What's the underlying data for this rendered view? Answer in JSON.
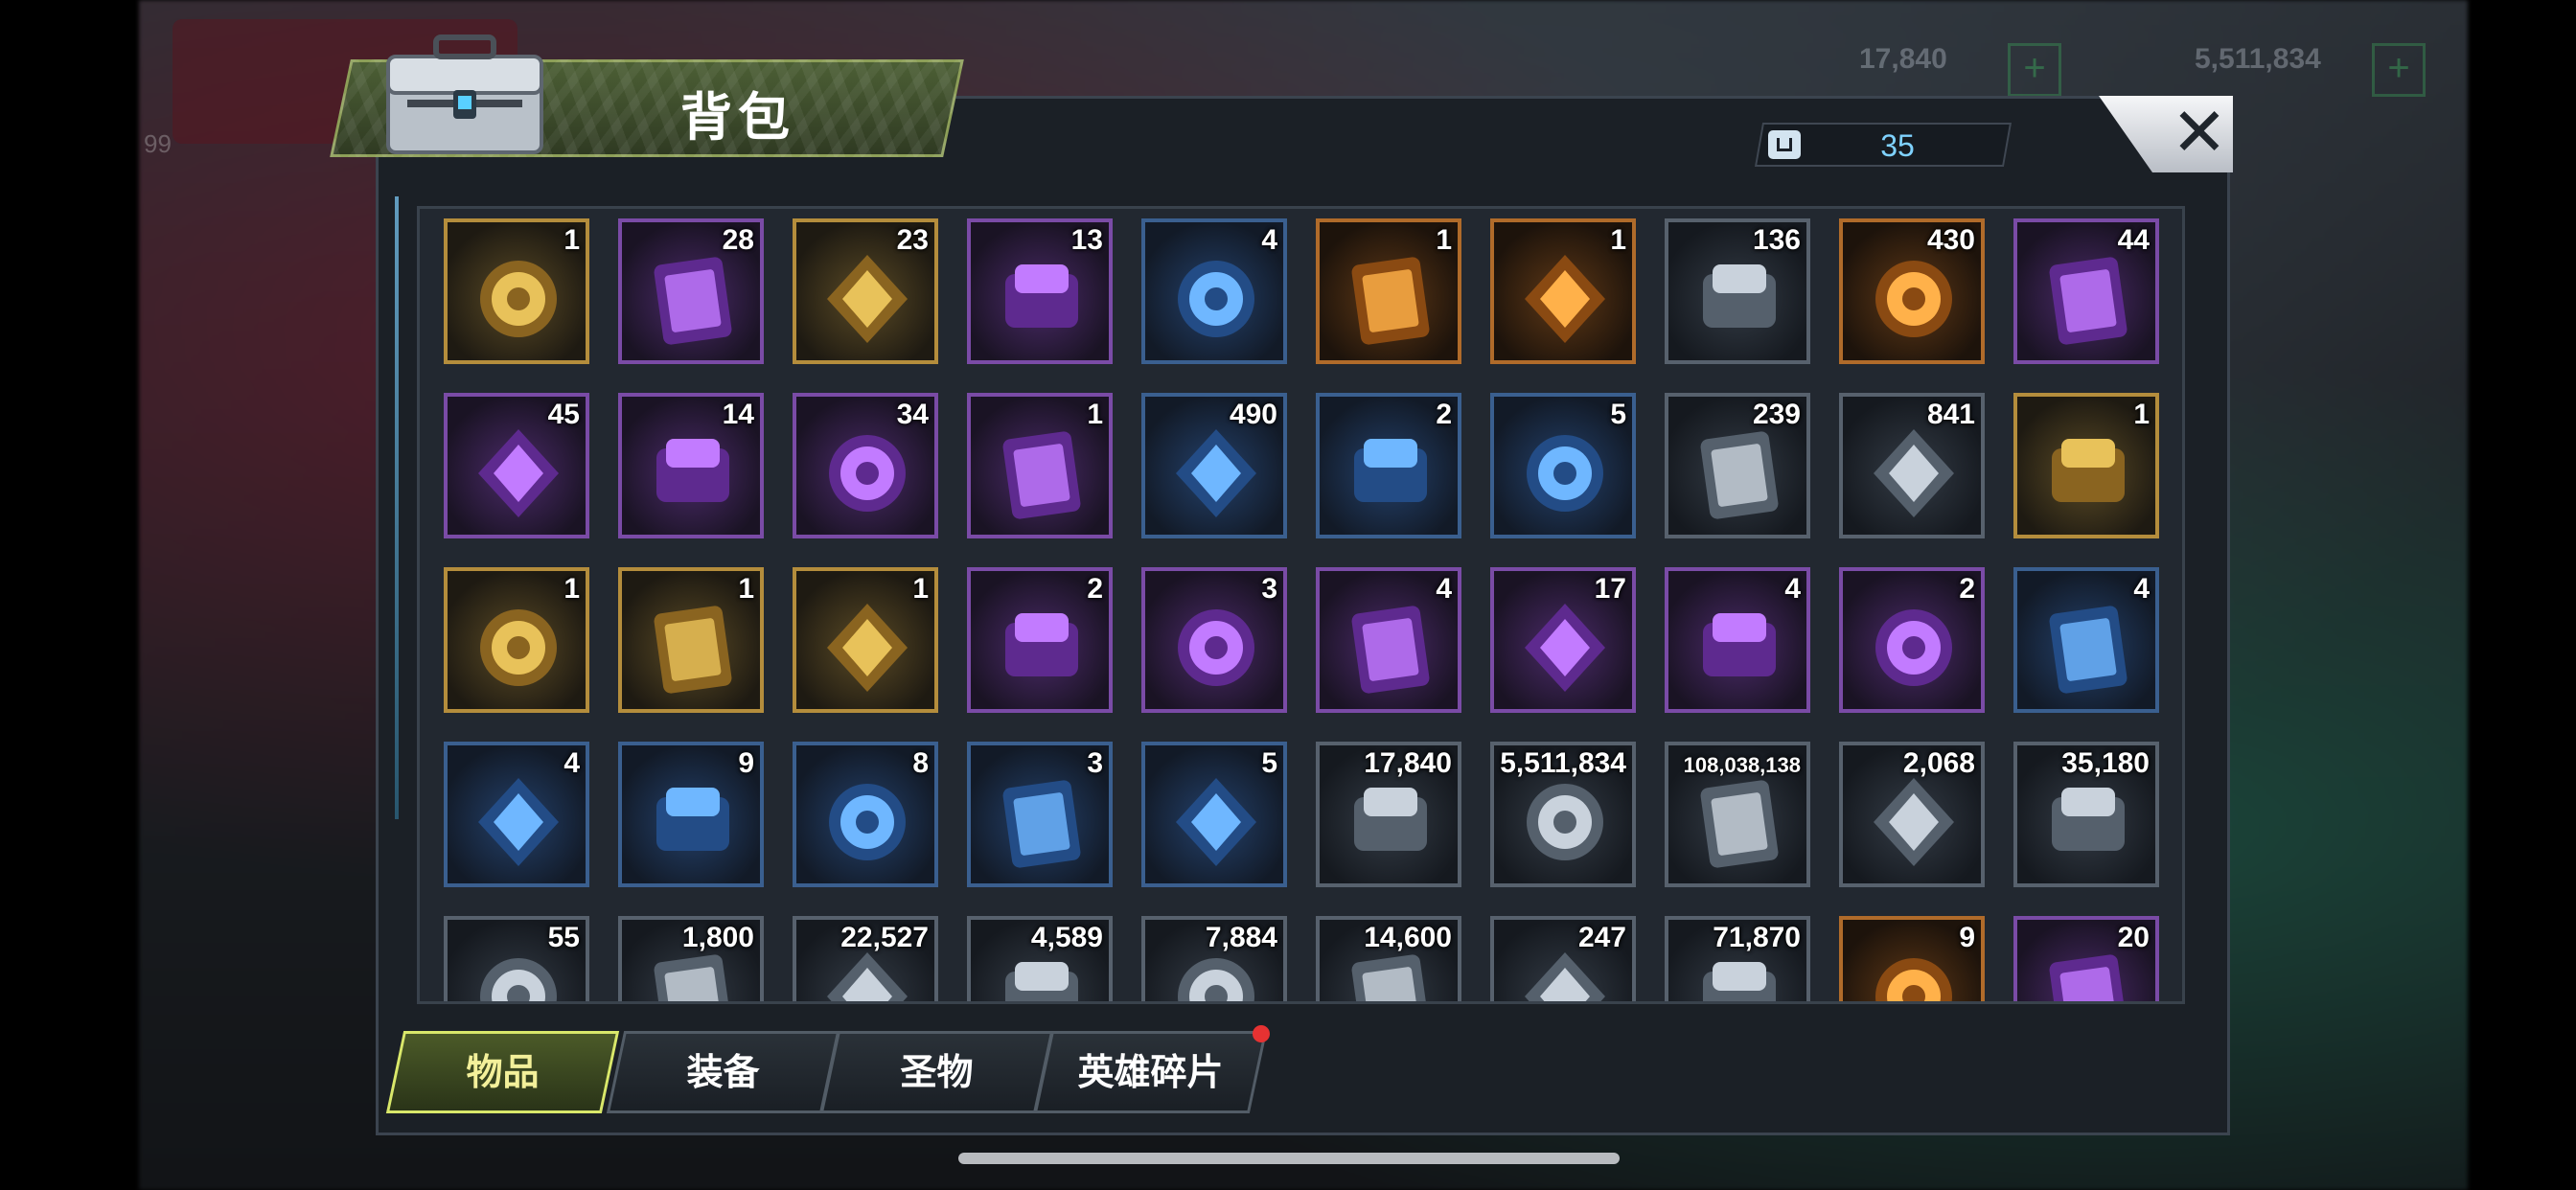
{
  "header": {
    "title": "背包"
  },
  "capacity": {
    "value": "35"
  },
  "background_hud": {
    "res1": "17,840",
    "res2": "5,511,834",
    "level": "99"
  },
  "close": {
    "label": "✕"
  },
  "items": [
    {
      "count": "1",
      "tier": "gold",
      "icon": "weapon-crate-icon"
    },
    {
      "count": "28",
      "tier": "purple",
      "icon": "teleport-device-icon"
    },
    {
      "count": "23",
      "tier": "gold",
      "icon": "speedup-24h-icon"
    },
    {
      "count": "13",
      "tier": "purple",
      "icon": "speedup-12h-icon"
    },
    {
      "count": "4",
      "tier": "blue",
      "icon": "speedup-4h-icon"
    },
    {
      "count": "1",
      "tier": "orange",
      "icon": "green-emblem-icon"
    },
    {
      "count": "1",
      "tier": "orange",
      "icon": "silver-emblem-icon"
    },
    {
      "count": "136",
      "tier": "gray",
      "icon": "bottle-cap-red-icon"
    },
    {
      "count": "430",
      "tier": "orange",
      "icon": "orange-slice-icon"
    },
    {
      "count": "44",
      "tier": "purple",
      "icon": "film-reel-icon"
    },
    {
      "count": "45",
      "tier": "purple",
      "icon": "bottle-cap-purple-icon"
    },
    {
      "count": "14",
      "tier": "purple",
      "icon": "poker-chip-purple-icon"
    },
    {
      "count": "34",
      "tier": "purple",
      "icon": "police-badge-icon"
    },
    {
      "count": "1",
      "tier": "purple",
      "icon": "lightsaber-icon"
    },
    {
      "count": "490",
      "tier": "blue",
      "icon": "cinema-ticket-icon"
    },
    {
      "count": "2",
      "tier": "blue",
      "icon": "timer-token-icon"
    },
    {
      "count": "5",
      "tier": "blue",
      "icon": "bottle-cap-blue-icon"
    },
    {
      "count": "239",
      "tier": "gray",
      "icon": "poker-chip-red-icon"
    },
    {
      "count": "841",
      "tier": "gray",
      "icon": "bullet-icon"
    },
    {
      "count": "1",
      "tier": "gold",
      "icon": "shirt-blueprint-gold-icon"
    },
    {
      "count": "1",
      "tier": "gold",
      "icon": "glasses-blueprint-gold-icon"
    },
    {
      "count": "1",
      "tier": "gold",
      "icon": "hat-blueprint-gold-icon"
    },
    {
      "count": "1",
      "tier": "gold",
      "icon": "boots-blueprint-gold-icon"
    },
    {
      "count": "2",
      "tier": "purple",
      "icon": "boots-blueprint-purple-icon"
    },
    {
      "count": "3",
      "tier": "purple",
      "icon": "glasses-blueprint-purple-icon"
    },
    {
      "count": "4",
      "tier": "purple",
      "icon": "hat-blueprint-purple-icon"
    },
    {
      "count": "17",
      "tier": "purple",
      "icon": "shirt-blueprint-purple-icon"
    },
    {
      "count": "4",
      "tier": "purple",
      "icon": "sword-blueprint-purple-icon"
    },
    {
      "count": "2",
      "tier": "purple",
      "icon": "gun-blueprint-purple-icon"
    },
    {
      "count": "4",
      "tier": "blue",
      "icon": "sword-blueprint-blue-icon"
    },
    {
      "count": "4",
      "tier": "blue",
      "icon": "glasses-blueprint-blue-icon"
    },
    {
      "count": "9",
      "tier": "blue",
      "icon": "shirt-blueprint-blue-icon"
    },
    {
      "count": "8",
      "tier": "blue",
      "icon": "hat-blueprint-blue-icon"
    },
    {
      "count": "3",
      "tier": "blue",
      "icon": "gun-blueprint-blue-icon"
    },
    {
      "count": "5",
      "tier": "blue",
      "icon": "boots-blueprint-blue-icon"
    },
    {
      "count": "17,840",
      "tier": "gray",
      "icon": "purple-crystal-icon"
    },
    {
      "count": "5,511,834",
      "tier": "gray",
      "icon": "gold-coins-icon"
    },
    {
      "count": "108,038,138",
      "tier": "gray",
      "icon": "green-canister-icon"
    },
    {
      "count": "2,068",
      "tier": "gray",
      "icon": "purple-orb-icon"
    },
    {
      "count": "35,180",
      "tier": "gray",
      "icon": "gear-icon"
    },
    {
      "count": "55",
      "tier": "gray",
      "icon": "red-emblem-icon"
    },
    {
      "count": "1,800",
      "tier": "gray",
      "icon": "shield-crate-icon"
    },
    {
      "count": "22,527",
      "tier": "gray",
      "icon": "silver-shard-icon"
    },
    {
      "count": "4,589",
      "tier": "gray",
      "icon": "gold-fist-icon"
    },
    {
      "count": "7,884",
      "tier": "gray",
      "icon": "purple-star-icon"
    },
    {
      "count": "14,600",
      "tier": "gray",
      "icon": "blue-medal-icon"
    },
    {
      "count": "247",
      "tier": "gray",
      "icon": "gold-medal-icon"
    },
    {
      "count": "71,870",
      "tier": "gray",
      "icon": "red-medal-icon"
    },
    {
      "count": "9",
      "tier": "orange",
      "icon": "orange-star-icon"
    },
    {
      "count": "20",
      "tier": "purple",
      "icon": "lightning-coin-icon"
    }
  ],
  "tabs": [
    {
      "label": "物品",
      "active": true
    },
    {
      "label": "装备",
      "active": false
    },
    {
      "label": "圣物",
      "active": false
    },
    {
      "label": "英雄碎片",
      "active": false
    }
  ]
}
